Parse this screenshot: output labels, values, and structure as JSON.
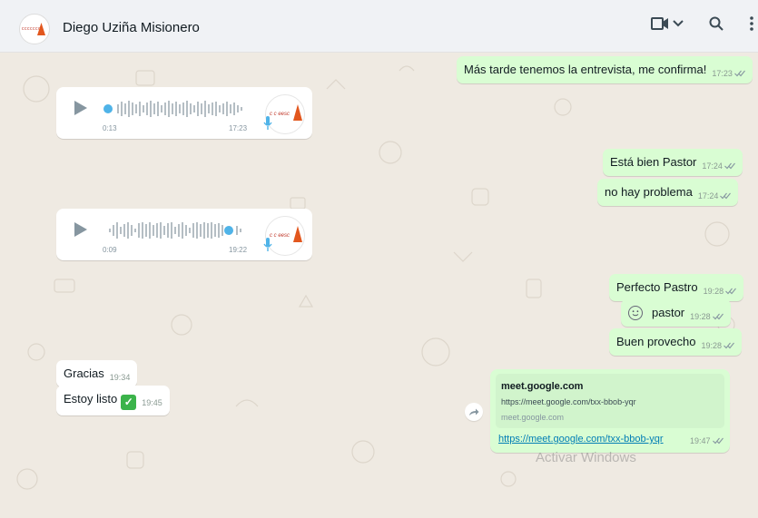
{
  "header": {
    "contact_name": "Diego Uziña Misionero",
    "avatar_icon": "church-logo-icon",
    "icons": [
      "video-call-icon",
      "chevron-down-icon",
      "search-icon",
      "menu-dots-icon"
    ]
  },
  "messages": [
    {
      "side": "out",
      "text": "Más tarde tenemos la entrevista, me confirma!",
      "time": "17:23"
    },
    {
      "side": "in",
      "kind": "voice",
      "duration": "0:13",
      "time": "17:23",
      "progress": 0.0
    },
    {
      "side": "out",
      "text": "Está bien Pastor",
      "time": "17:24"
    },
    {
      "side": "out",
      "text": "no hay problema",
      "time": "17:24"
    },
    {
      "side": "in",
      "kind": "voice",
      "duration": "0:09",
      "time": "19:22",
      "progress": 0.85
    },
    {
      "side": "out",
      "text": "Perfecto Pastro",
      "time": "19:28"
    },
    {
      "side": "out",
      "text": "pastor",
      "time": "19:28",
      "emoji": "slightly-smiling-face"
    },
    {
      "side": "out",
      "text": "Buen provecho",
      "time": "19:28"
    },
    {
      "side": "in",
      "text": "Gracias",
      "time": "19:34"
    },
    {
      "side": "in",
      "text": "Estoy listo",
      "time": "19:45",
      "emoji": "check-mark-button"
    }
  ],
  "link_message": {
    "title": "meet.google.com",
    "url": "https://meet.google.com/txx-bbob-yqr",
    "domain": "meet.google.com",
    "link_text": "https://meet.google.com/txx-bbob-yqr",
    "time": "19:47"
  },
  "watermark": "Activar Windows",
  "colors": {
    "outgoing_bubble": "#d9fdd3",
    "incoming_bubble": "#ffffff",
    "chat_background": "#efeae2",
    "read_ticks": "#53bdeb",
    "link": "#027eb5"
  }
}
